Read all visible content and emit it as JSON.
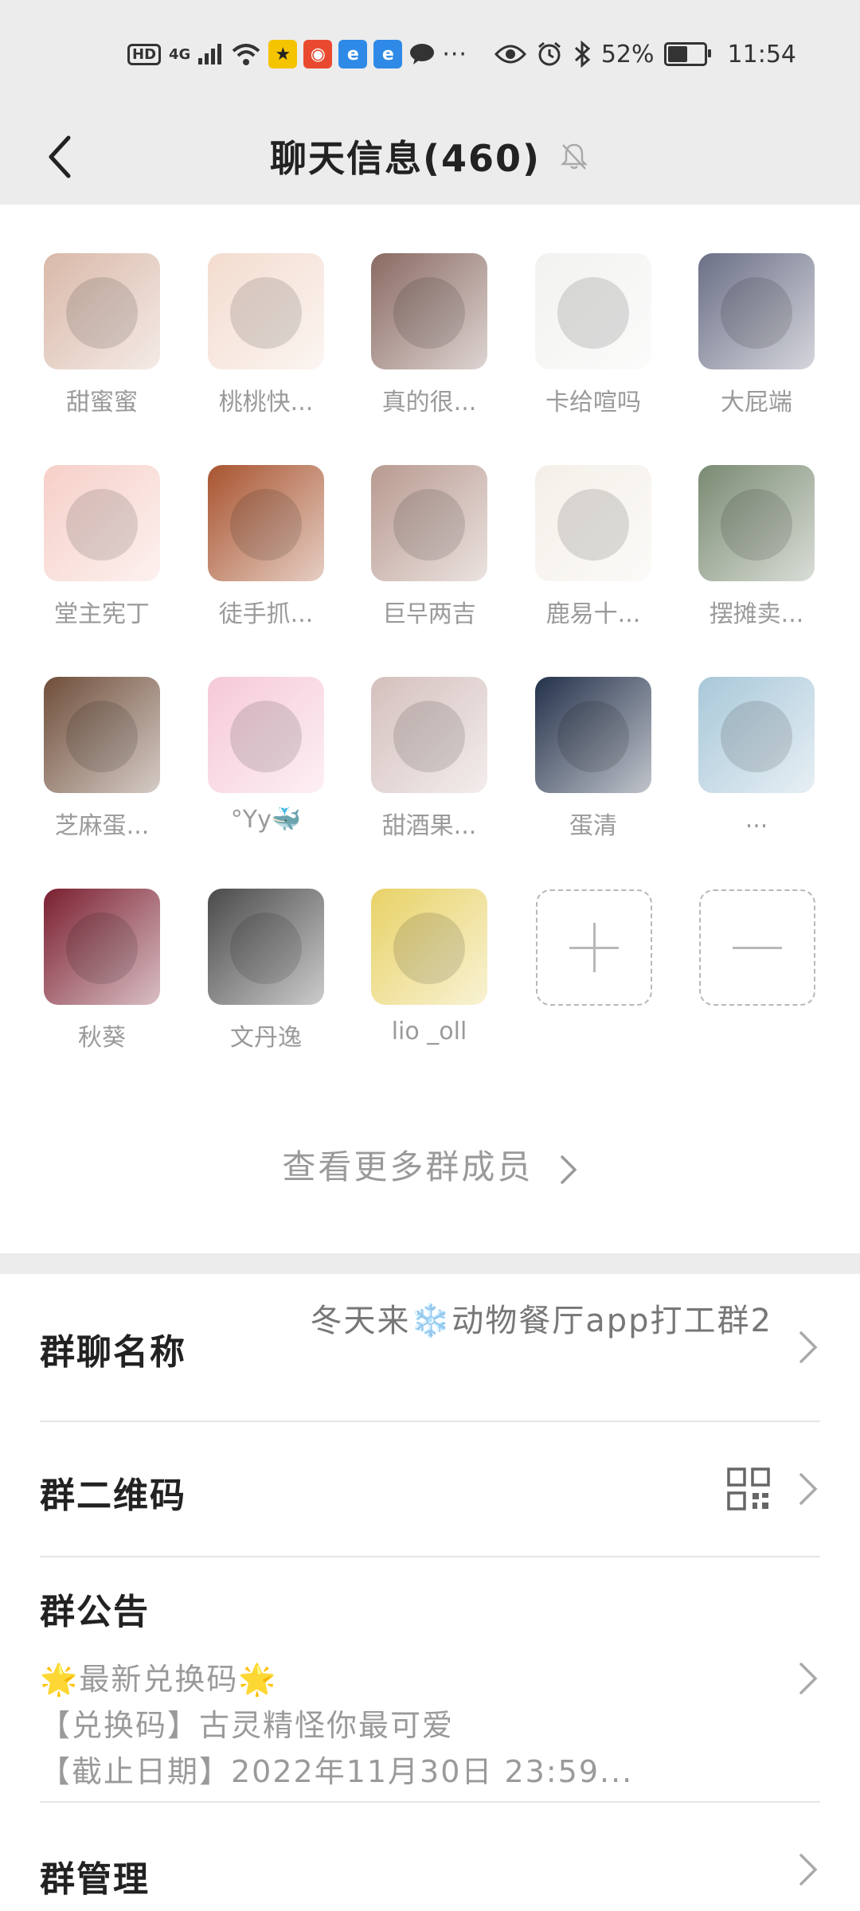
{
  "status_bar": {
    "hd_badge": "HD",
    "network": "4G",
    "more": "···",
    "battery": "52%",
    "time": "11:54"
  },
  "header": {
    "title": "聊天信息(460)"
  },
  "members": [
    {
      "name": "甜蜜蜜",
      "color": "#d9b8a8"
    },
    {
      "name": "桃桃快...",
      "color": "#f3dccf"
    },
    {
      "name": "真的很...",
      "color": "#8a6a62"
    },
    {
      "name": "卡给喧吗",
      "color": "#f2f2f0"
    },
    {
      "name": "大屁端",
      "color": "#6b6f86"
    },
    {
      "name": "堂主宪丁",
      "color": "#f6cfc8"
    },
    {
      "name": "徒手抓...",
      "color": "#a8542f"
    },
    {
      "name": "巨무两吉",
      "color": "#b89a90"
    },
    {
      "name": "鹿易十...",
      "color": "#f4efe8"
    },
    {
      "name": "摆摊卖...",
      "color": "#7a8a72"
    },
    {
      "name": "芝麻蛋...",
      "color": "#6f4e3a"
    },
    {
      "name": "°Yy🐳",
      "color": "#f6c9d8"
    },
    {
      "name": "甜酒果...",
      "color": "#d4c0bd"
    },
    {
      "name": "蛋清",
      "color": "#23314a"
    },
    {
      "name": "...",
      "color": "#a9c8d9"
    },
    {
      "name": "秋葵",
      "color": "#7a1f30"
    },
    {
      "name": "文丹逸",
      "color": "#4a4a4a"
    },
    {
      "name": "lio _oll",
      "color": "#e8d267"
    }
  ],
  "more_members": "查看更多群成员",
  "rows": {
    "group_name": {
      "label": "群聊名称",
      "value": "冬天来❄️动物餐厅app打工群2"
    },
    "group_qr": {
      "label": "群二维码"
    },
    "group_notice": {
      "label": "群公告",
      "line1": "🌟最新兑换码🌟",
      "line2": "【兑换码】古灵精怪你最可爱",
      "line3": "【截止日期】2022年11月30日 23:59..."
    },
    "group_manage": {
      "label": "群管理"
    }
  },
  "colors": {
    "header_bg": "#ececec",
    "muted_text": "#9a9a9a"
  }
}
